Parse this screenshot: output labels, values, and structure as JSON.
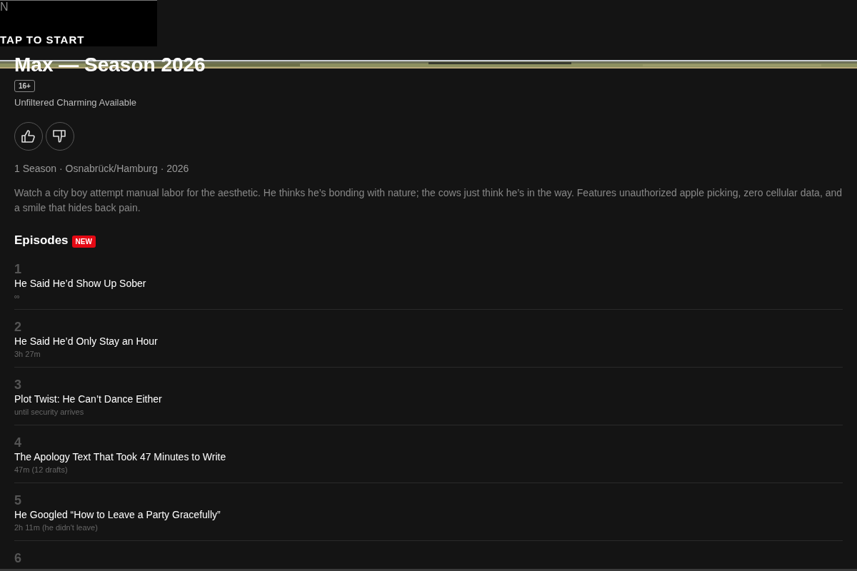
{
  "intro_overlay": {
    "logo": "N",
    "button": "TAP TO START"
  },
  "show": {
    "title": "Max — Season 2026",
    "rating": "16+",
    "tagline": "Unfiltered Charming Available",
    "meta": "1 Season · Osnabrück/Hamburg · 2026",
    "description": "Watch a city boy attempt manual labor for the aesthetic. He thinks he’s bonding with nature; the cows just think he’s in the way. Features unauthorized apple picking, zero cellular data, and a smile that hides back pain."
  },
  "episodes_heading": {
    "label": "Episodes",
    "badge": "NEW"
  },
  "episodes": [
    {
      "number": "1",
      "title": "He Said He’d Show Up Sober",
      "duration": "∞"
    },
    {
      "number": "2",
      "title": "He Said He’d Only Stay an Hour",
      "duration": "3h 27m"
    },
    {
      "number": "3",
      "title": "Plot Twist: He Can’t Dance Either",
      "duration": "until security arrives"
    },
    {
      "number": "4",
      "title": "The Apology Text That Took 47 Minutes to Write",
      "duration": "47m (12 drafts)"
    },
    {
      "number": "5",
      "title": "He Googled “How to Leave a Party Gracefully”",
      "duration": "2h 11m (he didn't leave)"
    },
    {
      "number": "6"
    }
  ]
}
